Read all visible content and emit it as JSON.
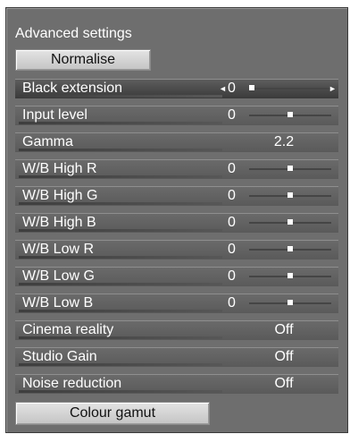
{
  "panel": {
    "title": "Advanced settings",
    "normalise_label": "Normalise",
    "colour_gamut_label": "Colour gamut"
  },
  "rows": [
    {
      "label": "Black extension",
      "value": "0",
      "kind": "slider",
      "level": 0.0,
      "selected": true,
      "arrow_left": "◄",
      "arrow_right": "►"
    },
    {
      "label": "Input level",
      "value": "0",
      "kind": "slider",
      "level": 0.5
    },
    {
      "label": "Gamma",
      "value": "2.2",
      "kind": "text"
    },
    {
      "label": "W/B High R",
      "value": "0",
      "kind": "slider",
      "level": 0.5
    },
    {
      "label": "W/B High G",
      "value": "0",
      "kind": "slider",
      "level": 0.5
    },
    {
      "label": "W/B High B",
      "value": "0",
      "kind": "slider",
      "level": 0.5
    },
    {
      "label": "W/B Low R",
      "value": "0",
      "kind": "slider",
      "level": 0.5
    },
    {
      "label": "W/B Low G",
      "value": "0",
      "kind": "slider",
      "level": 0.5
    },
    {
      "label": "W/B Low B",
      "value": "0",
      "kind": "slider",
      "level": 0.5
    },
    {
      "label": "Cinema reality",
      "value": "Off",
      "kind": "text"
    },
    {
      "label": "Studio Gain",
      "value": "Off",
      "kind": "text"
    },
    {
      "label": "Noise reduction",
      "value": "Off",
      "kind": "text"
    }
  ]
}
